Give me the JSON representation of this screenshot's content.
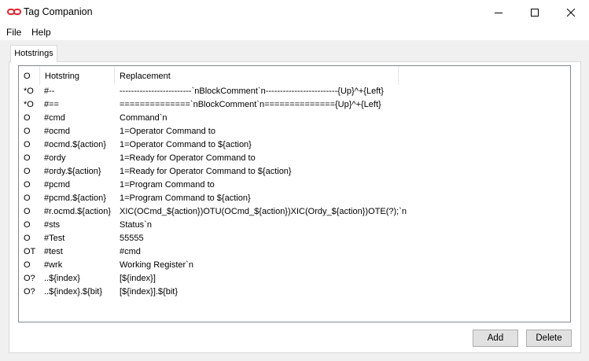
{
  "window": {
    "title": "Tag Companion",
    "icon": "chain-link-icon",
    "icon_color": "#e0262b"
  },
  "menu": {
    "file": "File",
    "help": "Help"
  },
  "tabs": [
    {
      "label": "Hotstrings",
      "selected": true
    }
  ],
  "list": {
    "headers": [
      "O",
      "Hotstring",
      "Replacement"
    ],
    "rows": [
      {
        "o": "*O",
        "hotstring": "#--",
        "replacement": "-------------------------`nBlockComment`n-------------------------{Up}^+{Left}"
      },
      {
        "o": "*O",
        "hotstring": "#==",
        "replacement": "==============`nBlockComment`n=============={Up}^+{Left}"
      },
      {
        "o": "O",
        "hotstring": "#cmd",
        "replacement": "Command`n"
      },
      {
        "o": "O",
        "hotstring": "#ocmd",
        "replacement": "1=Operator Command to"
      },
      {
        "o": "O",
        "hotstring": "#ocmd.${action}",
        "replacement": "1=Operator Command to ${action}"
      },
      {
        "o": "O",
        "hotstring": "#ordy",
        "replacement": "1=Ready for Operator Command to"
      },
      {
        "o": "O",
        "hotstring": "#ordy.${action}",
        "replacement": "1=Ready for Operator Command to ${action}"
      },
      {
        "o": "O",
        "hotstring": "#pcmd",
        "replacement": "1=Program Command to"
      },
      {
        "o": "O",
        "hotstring": "#pcmd.${action}",
        "replacement": "1=Program Command to ${action}"
      },
      {
        "o": "O",
        "hotstring": "#r.ocmd.${action}",
        "replacement": "XIC(OCmd_${action})OTU(OCmd_${action})XIC(Ordy_${action})OTE(?);`n"
      },
      {
        "o": "O",
        "hotstring": "#sts",
        "replacement": "Status`n"
      },
      {
        "o": "O",
        "hotstring": "#Test",
        "replacement": "55555"
      },
      {
        "o": "OT",
        "hotstring": "#test",
        "replacement": "#cmd"
      },
      {
        "o": "O",
        "hotstring": "#wrk",
        "replacement": "Working Register`n"
      },
      {
        "o": "O?",
        "hotstring": "..${index}",
        "replacement": "[${index}]"
      },
      {
        "o": "O?",
        "hotstring": "..${index}.${bit}",
        "replacement": "[${index}].${bit}"
      }
    ]
  },
  "buttons": {
    "add": "Add",
    "delete": "Delete"
  }
}
